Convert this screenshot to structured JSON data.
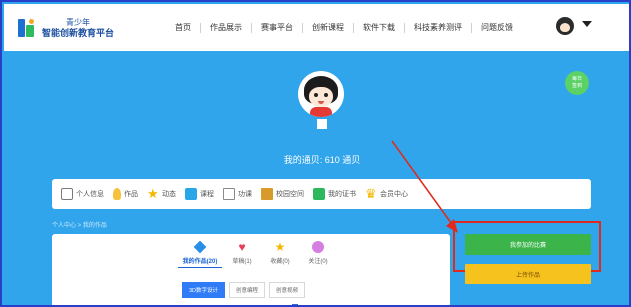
{
  "header": {
    "logo_line1": "青少年",
    "logo_line2": "智能创新教育平台",
    "nav": [
      "首页",
      "作品展示",
      "赛事平台",
      "创新课程",
      "软件下载",
      "科技素养测评",
      "问题反馈"
    ]
  },
  "profile": {
    "coins_text": "我的通贝: 610 通贝",
    "daily_checkin": [
      "每日",
      "签到"
    ]
  },
  "tabs": [
    "个人信息",
    "作品",
    "动态",
    "课程",
    "功课",
    "校园空间",
    "我的证书",
    "会员中心"
  ],
  "breadcrumb": "个人中心 > 我的作品",
  "works": {
    "stats": [
      {
        "label": "我的作品(20)",
        "icon": "cube-icon"
      },
      {
        "label": "草稿(1)",
        "icon": "heart-icon"
      },
      {
        "label": "收藏(0)",
        "icon": "star-icon"
      },
      {
        "label": "关注(0)",
        "icon": "follow-icon"
      }
    ],
    "subtabs": [
      "3D数字设计",
      "创意编程",
      "创意视频"
    ]
  },
  "actions": {
    "my_competitions": "我参加的比赛",
    "upload_work": "上传作品"
  },
  "colors": {
    "background": "#31a5ec",
    "highlight": "#e02a1f",
    "competition_button": "#3bb54a",
    "upload_button": "#f6c21e"
  }
}
